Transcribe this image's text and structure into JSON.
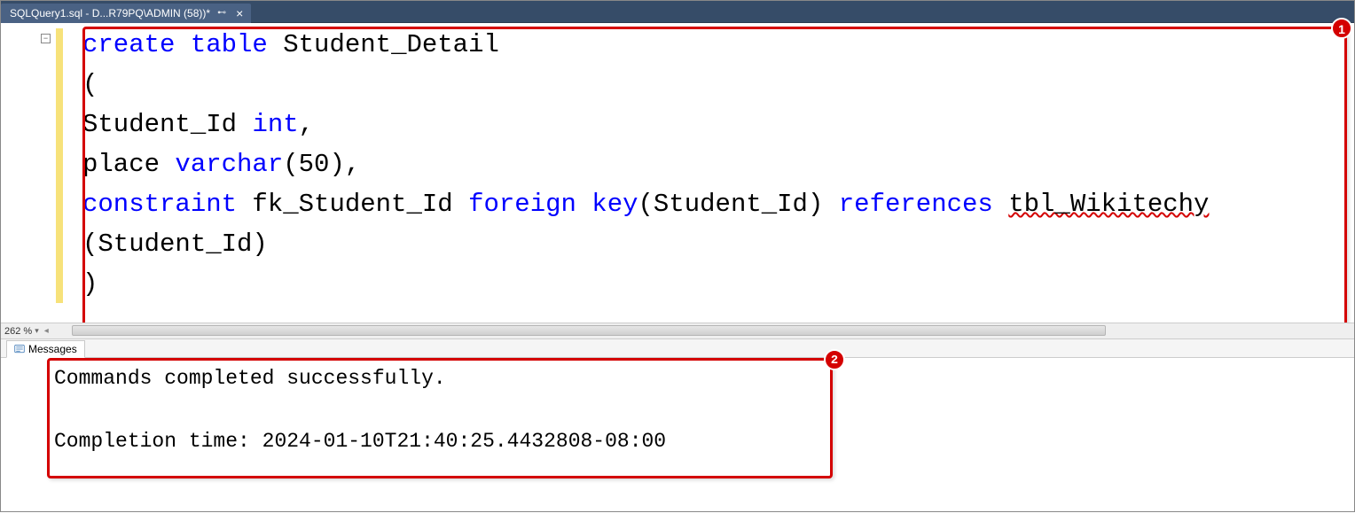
{
  "tab": {
    "title": "SQLQuery1.sql - D...R79PQ\\ADMIN (58))*",
    "close": "×",
    "pin": "⊷"
  },
  "gutter": {
    "fold": "−"
  },
  "code": {
    "l1_kw1": "create",
    "l1_kw2": " table",
    "l1_id": " Student_Detail",
    "l2": "(",
    "l3_id": "Student_Id ",
    "l3_kw": "int",
    "l3_tail": ",",
    "l4_id": "place ",
    "l4_kw": "varchar",
    "l4_tail": "(50),",
    "l5_kw1": "constraint",
    "l5_id1": " fk_Student_Id ",
    "l5_kw2": "foreign",
    "l5_kw3": " key",
    "l5_mid": "(Student_Id) ",
    "l5_kw4": "references",
    "l5_sp": " ",
    "l5_err": "tbl_Wikitechy",
    "l6": "(Student_Id)",
    "l7": ")"
  },
  "zoom": {
    "value": "262 %"
  },
  "messagesTab": {
    "label": "Messages"
  },
  "messages": {
    "line1": "Commands completed successfully.",
    "blank": "",
    "line2": "Completion time: 2024-01-10T21:40:25.4432808-08:00"
  },
  "annotations": {
    "n1": "1",
    "n2": "2"
  }
}
